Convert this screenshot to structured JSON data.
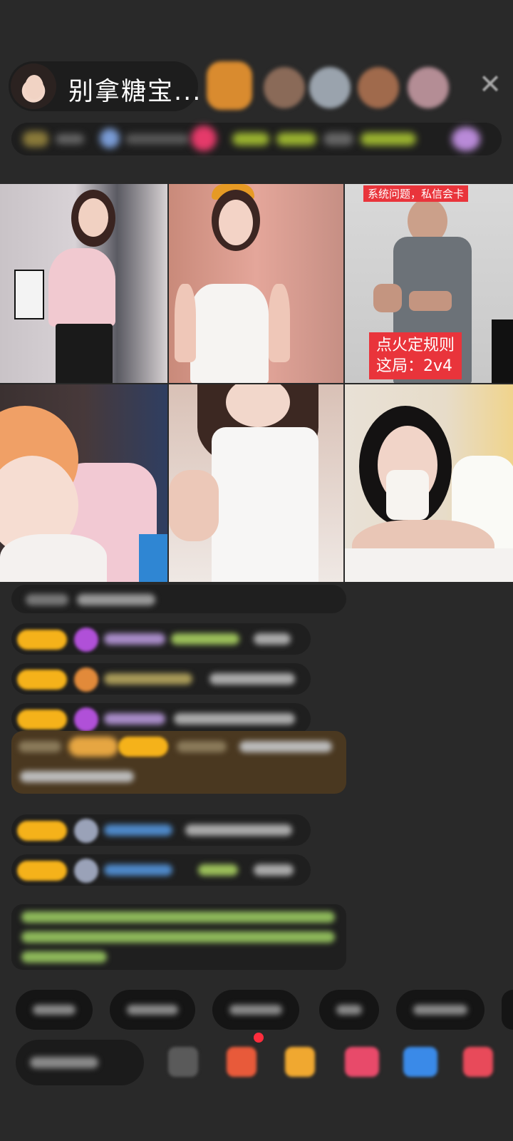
{
  "header": {
    "host_name": "别拿糖宝...",
    "viewers": [
      "viewer-avatar-1",
      "viewer-avatar-2",
      "viewer-avatar-3",
      "viewer-avatar-4",
      "viewer-avatar-5"
    ],
    "close_icon": "close-icon"
  },
  "grid": {
    "tile3_tag": "系统问题，私信会卡",
    "tile3_rule": "点火定规则\n这局：2v4"
  },
  "colors": {
    "background": "#292929",
    "level_badge": "#f5b21a",
    "overlay_red": "#e9343b",
    "gift_card": "#4a3820"
  }
}
